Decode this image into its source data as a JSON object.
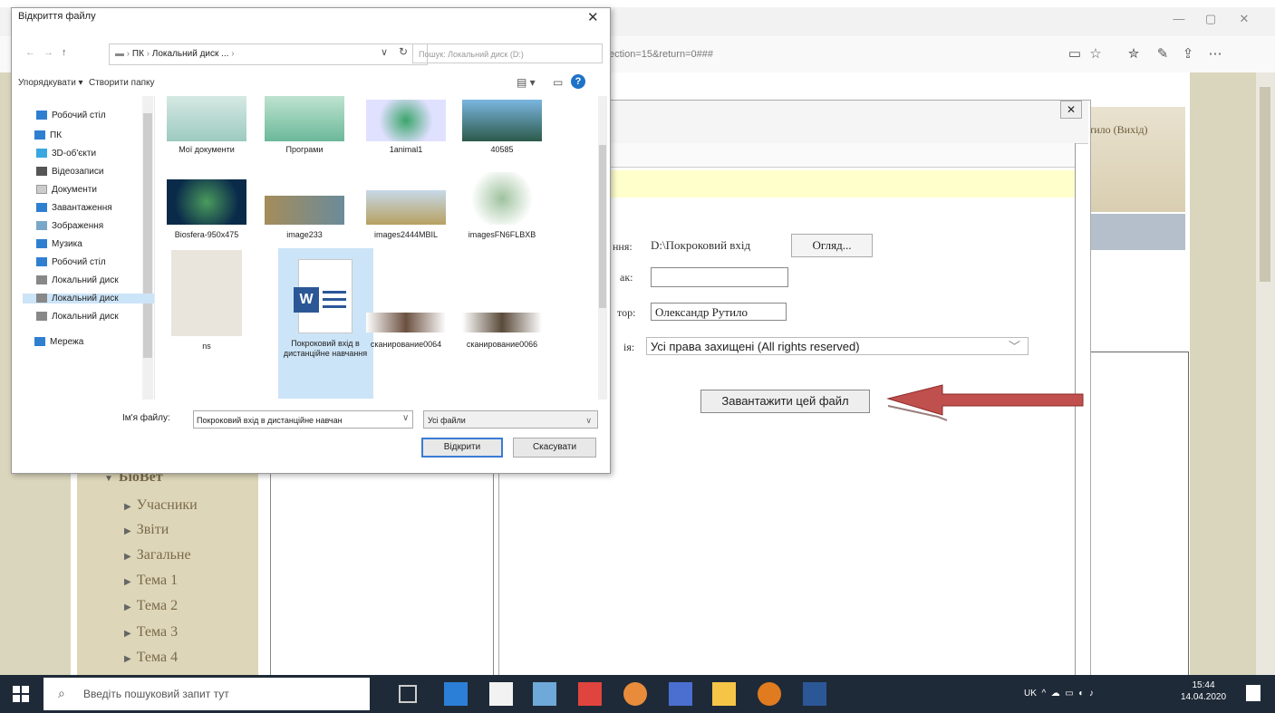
{
  "browser": {
    "url": "ection=15&return=0###",
    "window_controls": [
      "—",
      "▢",
      "✕"
    ],
    "toolbar_icons": [
      "reader-view-icon",
      "favorite-star-icon",
      "favorites-list-icon",
      "pen-icon",
      "share-icon",
      "more-icon"
    ]
  },
  "site": {
    "user_link": "утило (Вихід)",
    "sidebar_tree": {
      "root": "БіоВет",
      "items": [
        "Учасники",
        "Звіти",
        "Загальне",
        "Тема 1",
        "Тема 2",
        "Тема 3",
        "Тема 4"
      ]
    }
  },
  "upload_form": {
    "file_label": "ння:",
    "file_path": "D:\\Покроковий вхід",
    "browse_label": "Огляд...",
    "name_label": "ак:",
    "author_label": "тор:",
    "author_value": "Олександр Рутило",
    "license_label": "ія:",
    "license_value": "Усі права захищені (All rights reserved)",
    "upload_button": "Завантажити цей файл",
    "close": "✕"
  },
  "file_dialog": {
    "title": "Відкриття файлу",
    "path_segments": [
      "ПК",
      "Локальний диск ..."
    ],
    "search_placeholder": "Пошук: Локальний диск (D:)",
    "organize_label": "Упорядкувати ▾",
    "new_folder_label": "Створити папку",
    "nav_items": [
      "Робочий стіл",
      "ПК",
      "3D-об'єкти",
      "Відеозаписи",
      "Документи",
      "Завантаження",
      "Зображення",
      "Музика",
      "Робочий стіл",
      "Локальний диск",
      "Локальний диск",
      "Локальний диск",
      "Мережа"
    ],
    "files": [
      {
        "name": "Мої документи"
      },
      {
        "name": "Програми"
      },
      {
        "name": "1animal1"
      },
      {
        "name": "40585"
      },
      {
        "name": "Biosfera-950x475"
      },
      {
        "name": "image233"
      },
      {
        "name": "images2444MBIL"
      },
      {
        "name": "imagesFN6FLBXB"
      },
      {
        "name": "ns"
      },
      {
        "name": "Покроковий вхід в дистанційне навчання"
      },
      {
        "name": "сканирование0064"
      },
      {
        "name": "сканирование0066"
      }
    ],
    "filename_label": "Ім'я файлу:",
    "filename_value": "Покроковий вхід в дистанційне навчан",
    "filetype_value": "Усі файли",
    "open_button": "Відкрити",
    "cancel_button": "Скасувати"
  },
  "taskbar": {
    "search_placeholder": "Введіть пошуковий запит тут",
    "tray_lang": "UK",
    "time": "15:44",
    "date": "14.04.2020"
  }
}
